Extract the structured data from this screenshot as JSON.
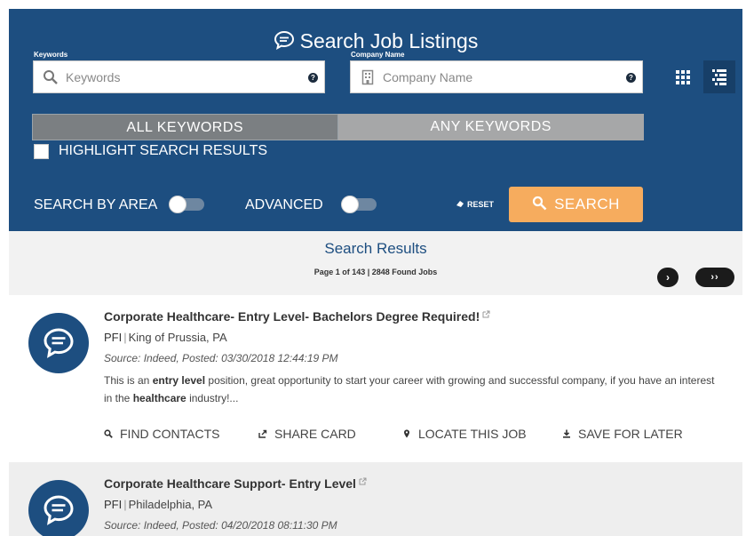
{
  "header": {
    "title": "Search Job Listings",
    "keywords_label": "Keywords",
    "keywords_placeholder": "Keywords",
    "company_label": "Company Name",
    "company_placeholder": "Company Name",
    "help_glyph": "?",
    "view_modes": [
      "grid",
      "list"
    ],
    "active_view": "list"
  },
  "keyword_mode": {
    "all_label": "ALL KEYWORDS",
    "any_label": "ANY KEYWORDS",
    "selected": "all"
  },
  "highlight": {
    "label": "HIGHLIGHT SEARCH RESULTS",
    "checked": false
  },
  "options": {
    "search_by_area_label": "SEARCH BY AREA",
    "search_by_area_on": false,
    "advanced_label": "ADVANCED",
    "advanced_on": false,
    "reset_label": "RESET",
    "search_label": "SEARCH"
  },
  "results": {
    "title": "Search Results",
    "meta": "Page 1 of 143 | 2848 Found Jobs",
    "next_glyph": "›",
    "last_glyph": "››"
  },
  "jobs": [
    {
      "title": "Corporate Healthcare- Entry Level- Bachelors Degree Required!",
      "company": "PFI",
      "location": "King of Prussia, PA",
      "source": "Source: Indeed,   Posted: 03/30/2018 12:44:19 PM",
      "desc_1": "This is an ",
      "desc_b1": "entry level",
      "desc_2": " position, great opportunity to start your career with growing and successful company, if you have an interest in the ",
      "desc_b2": "healthcare",
      "desc_3": " industry!..."
    },
    {
      "title": "Corporate Healthcare Support- Entry Level",
      "company": "PFI",
      "location": "Philadelphia, PA",
      "source": "Source: Indeed,   Posted: 04/20/2018 08:11:30 PM"
    }
  ],
  "actions": {
    "find_contacts": "FIND CONTACTS",
    "share_card": "SHARE CARD",
    "locate_job": "LOCATE THIS JOB",
    "save_later": "SAVE FOR LATER"
  },
  "colors": {
    "panel_blue": "#1d4e80",
    "search_orange": "#f6ac5e",
    "toggle_gray": "#a6a7a8"
  }
}
